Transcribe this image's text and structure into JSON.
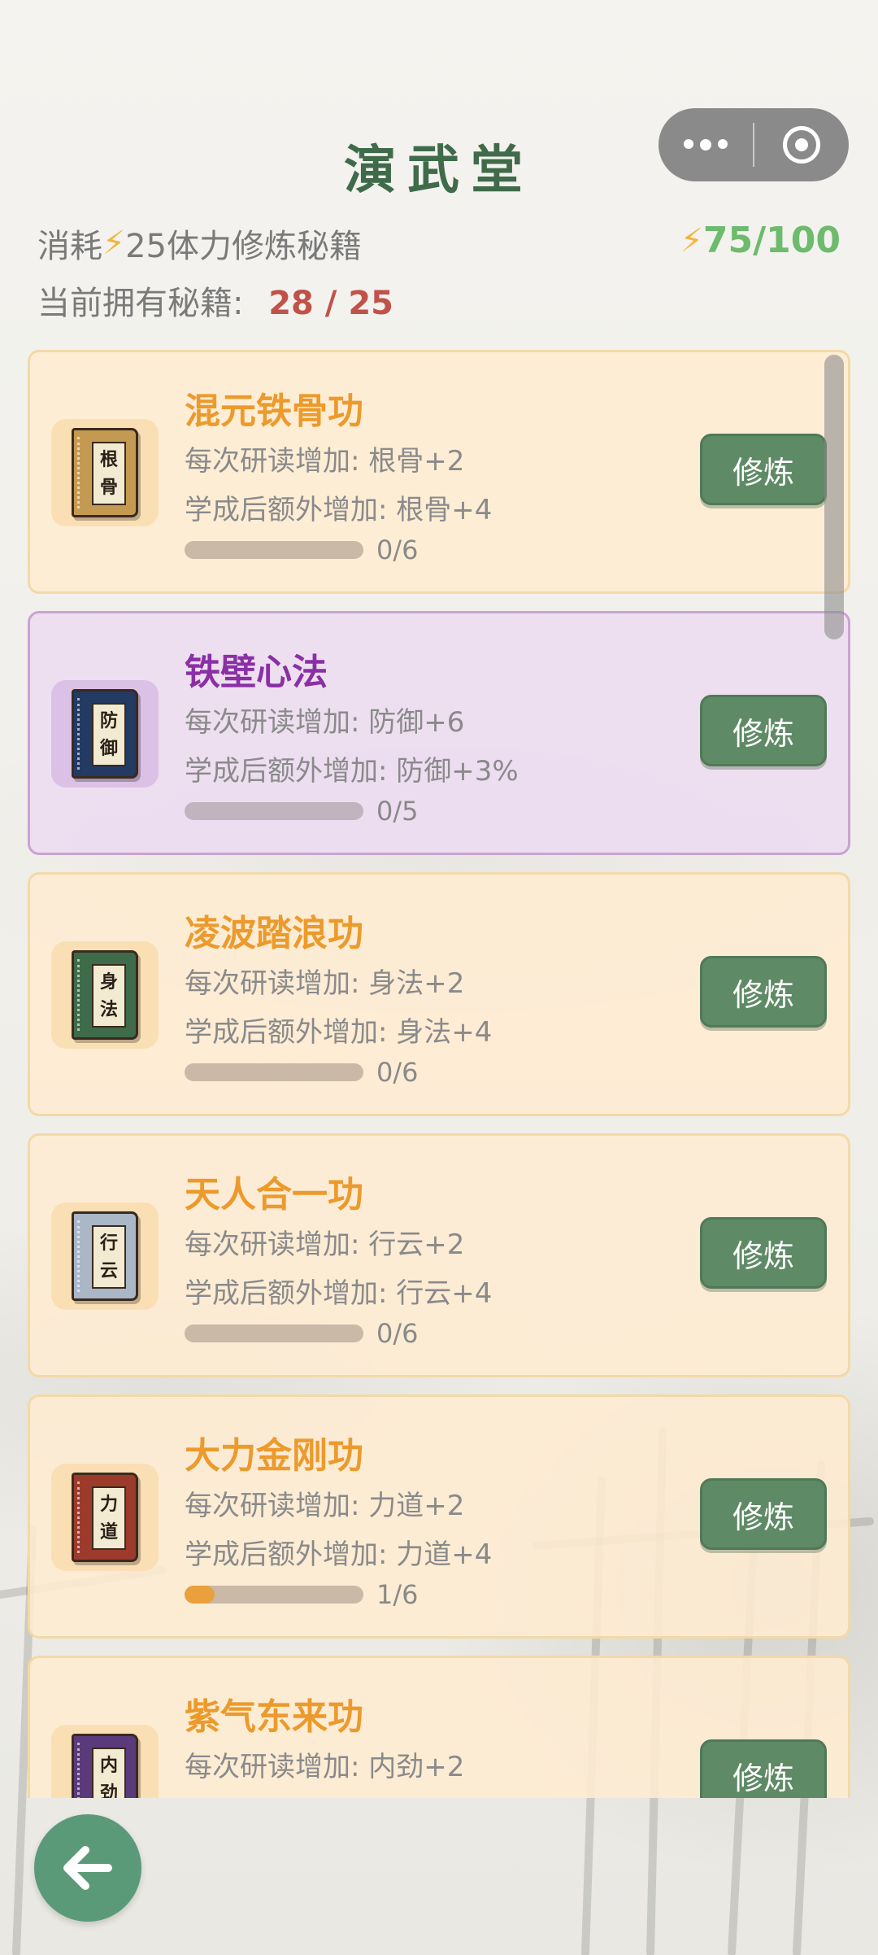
{
  "header": {
    "title": "演武堂",
    "menu_icon": "more-dots-icon",
    "close_icon": "target-close-icon"
  },
  "info": {
    "cost_prefix": "消耗",
    "cost_amount": "25体力修炼秘籍",
    "stamina": "75/100",
    "owned_label": "当前拥有秘籍:",
    "owned_count": "28 / 25"
  },
  "colors": {
    "title": "#3f6b4a",
    "stamina": "#6dbb6d",
    "owned": "#c0524a",
    "card_orange_title": "#ec9a2c",
    "card_purple_title": "#8a2fa6",
    "button": "#5f8a66",
    "progress_fill": "#eaa13c"
  },
  "manuals": [
    {
      "title": "混元铁骨功",
      "book_chars": [
        "根",
        "骨"
      ],
      "book_color": "#c49a52",
      "stat_per_read": "每次研读增加: 根骨+2",
      "stat_bonus": "学成后额外增加: 根骨+4",
      "progress": "0/6",
      "progress_value": 0,
      "button": "修炼",
      "rarity": "orange"
    },
    {
      "title": "铁壁心法",
      "book_chars": [
        "防",
        "御"
      ],
      "book_color": "#233a63",
      "stat_per_read": "每次研读增加: 防御+6",
      "stat_bonus": "学成后额外增加: 防御+3%",
      "progress": "0/5",
      "progress_value": 0,
      "button": "修炼",
      "rarity": "purple"
    },
    {
      "title": "凌波踏浪功",
      "book_chars": [
        "身",
        "法"
      ],
      "book_color": "#3e6b4a",
      "stat_per_read": "每次研读增加: 身法+2",
      "stat_bonus": "学成后额外增加: 身法+4",
      "progress": "0/6",
      "progress_value": 0,
      "button": "修炼",
      "rarity": "orange"
    },
    {
      "title": "天人合一功",
      "book_chars": [
        "行",
        "云"
      ],
      "book_color": "#a9b7c6",
      "stat_per_read": "每次研读增加: 行云+2",
      "stat_bonus": "学成后额外增加: 行云+4",
      "progress": "0/6",
      "progress_value": 0,
      "button": "修炼",
      "rarity": "orange"
    },
    {
      "title": "大力金刚功",
      "book_chars": [
        "力",
        "道"
      ],
      "book_color": "#9c3b2c",
      "stat_per_read": "每次研读增加: 力道+2",
      "stat_bonus": "学成后额外增加: 力道+4",
      "progress": "1/6",
      "progress_value": 0.1667,
      "button": "修炼",
      "rarity": "orange"
    },
    {
      "title": "紫气东来功",
      "book_chars": [
        "内",
        "劲"
      ],
      "book_color": "#5a3a7a",
      "stat_per_read": "每次研读增加: 内劲+2",
      "stat_bonus": "",
      "progress": "",
      "progress_value": 0,
      "button": "修炼",
      "rarity": "orange"
    }
  ],
  "back_icon": "arrow-left-icon"
}
